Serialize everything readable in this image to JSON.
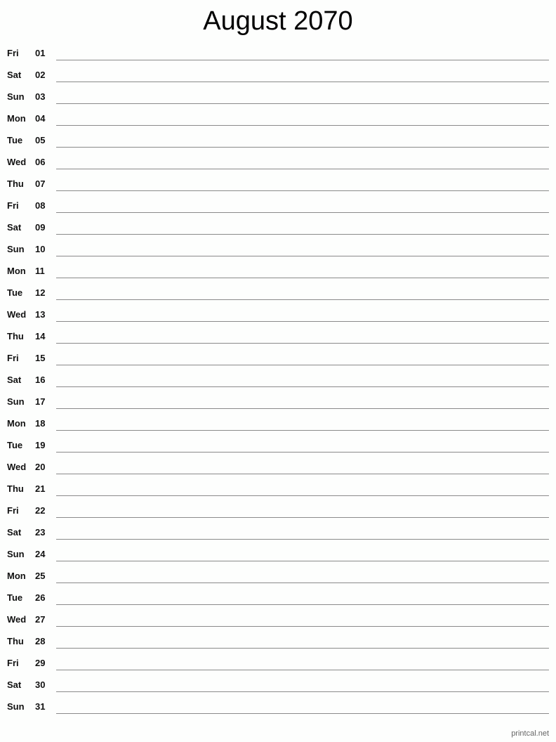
{
  "title": "August 2070",
  "days": [
    {
      "dow": "Fri",
      "day": "01"
    },
    {
      "dow": "Sat",
      "day": "02"
    },
    {
      "dow": "Sun",
      "day": "03"
    },
    {
      "dow": "Mon",
      "day": "04"
    },
    {
      "dow": "Tue",
      "day": "05"
    },
    {
      "dow": "Wed",
      "day": "06"
    },
    {
      "dow": "Thu",
      "day": "07"
    },
    {
      "dow": "Fri",
      "day": "08"
    },
    {
      "dow": "Sat",
      "day": "09"
    },
    {
      "dow": "Sun",
      "day": "10"
    },
    {
      "dow": "Mon",
      "day": "11"
    },
    {
      "dow": "Tue",
      "day": "12"
    },
    {
      "dow": "Wed",
      "day": "13"
    },
    {
      "dow": "Thu",
      "day": "14"
    },
    {
      "dow": "Fri",
      "day": "15"
    },
    {
      "dow": "Sat",
      "day": "16"
    },
    {
      "dow": "Sun",
      "day": "17"
    },
    {
      "dow": "Mon",
      "day": "18"
    },
    {
      "dow": "Tue",
      "day": "19"
    },
    {
      "dow": "Wed",
      "day": "20"
    },
    {
      "dow": "Thu",
      "day": "21"
    },
    {
      "dow": "Fri",
      "day": "22"
    },
    {
      "dow": "Sat",
      "day": "23"
    },
    {
      "dow": "Sun",
      "day": "24"
    },
    {
      "dow": "Mon",
      "day": "25"
    },
    {
      "dow": "Tue",
      "day": "26"
    },
    {
      "dow": "Wed",
      "day": "27"
    },
    {
      "dow": "Thu",
      "day": "28"
    },
    {
      "dow": "Fri",
      "day": "29"
    },
    {
      "dow": "Sat",
      "day": "30"
    },
    {
      "dow": "Sun",
      "day": "31"
    }
  ],
  "footer": "printcal.net"
}
